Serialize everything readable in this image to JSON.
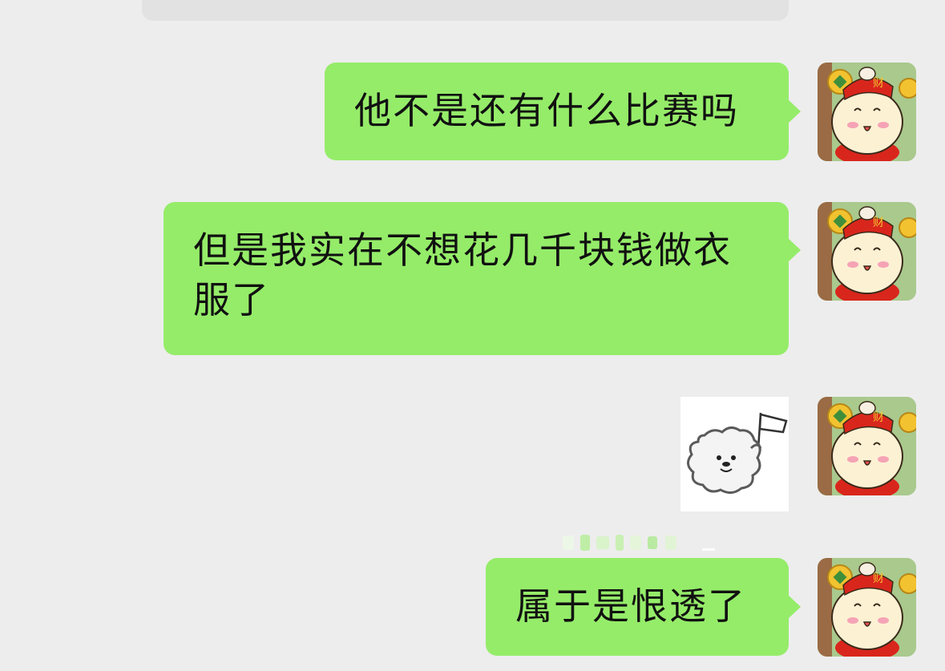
{
  "messages": [
    {
      "id": "m1",
      "side": "right",
      "type": "text",
      "text": "他不是还有什么比赛吗"
    },
    {
      "id": "m2",
      "side": "right",
      "type": "text",
      "text": "但是我实在不想花几千块钱做衣服了"
    },
    {
      "id": "m3",
      "side": "right",
      "type": "sticker",
      "sticker_icon": "fluffy-dog-waving-flag-icon"
    },
    {
      "id": "m4",
      "side": "right",
      "type": "text",
      "text": "属于是恨透了"
    }
  ],
  "avatar": {
    "icon": "fortune-god-bunny-avatar-icon",
    "hat_text": "财"
  },
  "colors": {
    "background": "#ededed",
    "bubble": "#95ec69",
    "text": "#111111",
    "avatar_hat": "#d9261c"
  }
}
